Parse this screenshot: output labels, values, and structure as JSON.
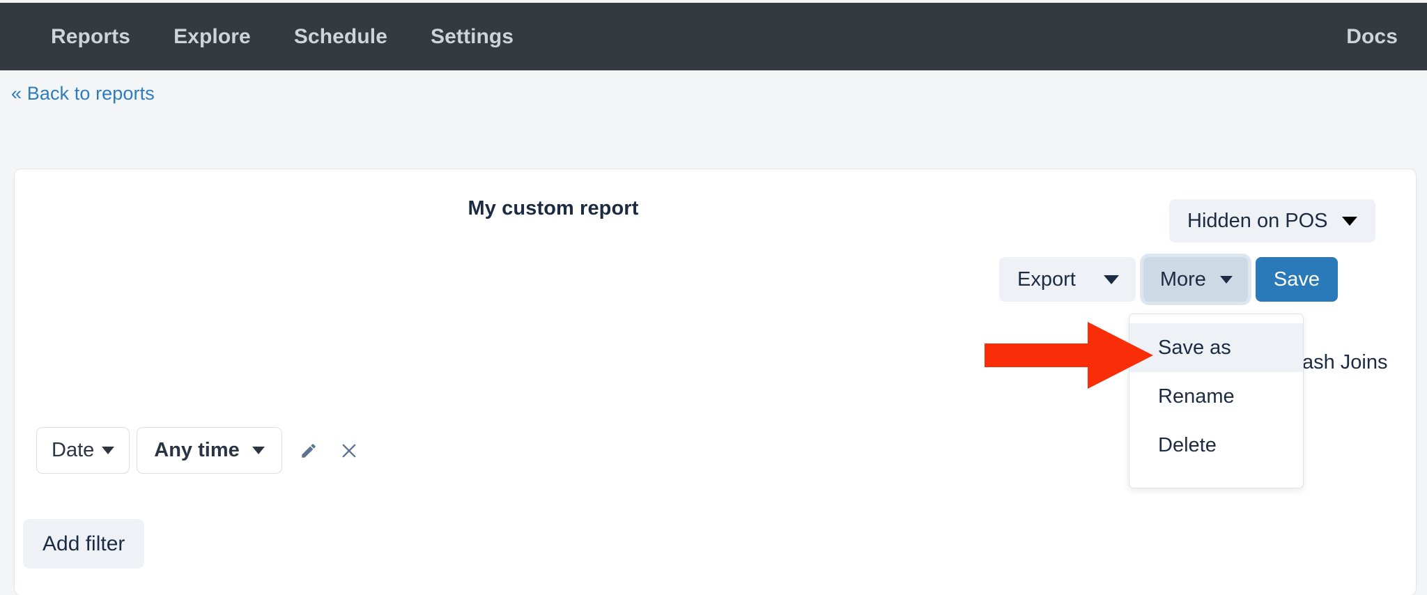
{
  "navbar": {
    "items": [
      {
        "label": "Reports"
      },
      {
        "label": "Explore"
      },
      {
        "label": "Schedule"
      },
      {
        "label": "Settings"
      }
    ],
    "right_items": [
      {
        "label": "Docs"
      }
    ],
    "background_color": "#343a40",
    "link_color": "#ced4da"
  },
  "breadcrumb": {
    "back_label": "« Back to reports",
    "color": "#2b7cc0"
  },
  "report": {
    "title": "My custom report",
    "visibility": {
      "label": "Hidden on POS",
      "caret_icon": "chevron-down-icon"
    },
    "partially_hidden_text": "Hash Joins"
  },
  "toolbar": {
    "export_label": "Export",
    "export_caret_icon": "chevron-down-icon",
    "more_label": "More",
    "more_caret_icon": "chevron-down-icon",
    "save_label": "Save",
    "save_color": "#2a7ab9"
  },
  "more_menu": {
    "open": true,
    "items": [
      {
        "label": "Save as",
        "active": true
      },
      {
        "label": "Rename",
        "active": false
      },
      {
        "label": "Delete",
        "active": false
      }
    ],
    "highlight_color": "#eef1f6"
  },
  "annotation": {
    "arrow_icon": "right-arrow-annotation",
    "color": "#f92d08",
    "points_at": "Save as"
  },
  "filters": {
    "pills": [
      {
        "label": "Date",
        "caret_icon": "chevron-down-icon",
        "bold": false
      },
      {
        "label": "Any time",
        "caret_icon": "chevron-down-icon",
        "bold": true
      }
    ],
    "edit_icon": "pencil-icon",
    "remove_icon": "close-icon",
    "add_filter_label": "Add filter"
  }
}
